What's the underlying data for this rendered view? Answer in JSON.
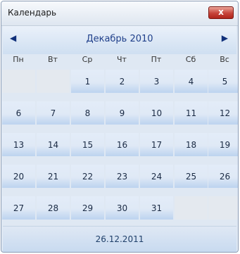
{
  "window": {
    "title": "Календарь",
    "close_label": "x"
  },
  "nav": {
    "prev_icon": "◀",
    "next_icon": "▶",
    "month_label": "Декабрь 2010"
  },
  "weekdays": [
    "Пн",
    "Вт",
    "Ср",
    "Чт",
    "Пт",
    "Сб",
    "Вс"
  ],
  "weeks": [
    [
      "",
      "",
      "1",
      "2",
      "3",
      "4",
      "5"
    ],
    [
      "6",
      "7",
      "8",
      "9",
      "10",
      "11",
      "12"
    ],
    [
      "13",
      "14",
      "15",
      "16",
      "17",
      "18",
      "19"
    ],
    [
      "20",
      "21",
      "22",
      "23",
      "24",
      "25",
      "26"
    ],
    [
      "27",
      "28",
      "29",
      "30",
      "31",
      "",
      ""
    ]
  ],
  "footer": {
    "today_label": "26.12.2011"
  }
}
